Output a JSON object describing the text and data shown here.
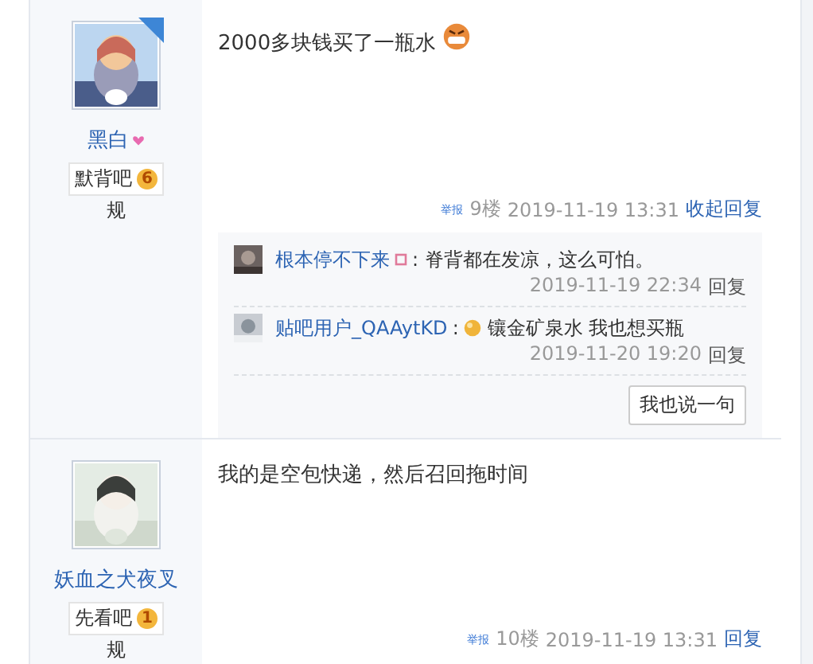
{
  "posts": [
    {
      "author": {
        "name": "黑白",
        "name_icon": true,
        "badge_forum": "默背吧",
        "badge_level": "6",
        "badge_tail": "规"
      },
      "op": true,
      "content": "2000多块钱买了一瓶水",
      "emoticon": {
        "kind": "grimace"
      },
      "report": "举报",
      "floor": "9楼",
      "time": "2019-11-19 13:31",
      "action": "收起回复",
      "replies": [
        {
          "name": "根本停不下来",
          "name_icon": true,
          "text": ": 脊背都在发凉，这么可怕。",
          "time": "2019-11-19 22:34",
          "action": "回复"
        },
        {
          "name": "贴吧用户_QAAytKD",
          "name_icon": false,
          "emoticon": {
            "kind": "orb"
          },
          "text": ": ",
          "text2": "镶金矿泉水 我也想买瓶",
          "time": "2019-11-20 19:20",
          "action": "回复"
        }
      ],
      "reply_button": "我也说一句"
    },
    {
      "author": {
        "name": "妖血之犬夜叉",
        "name_icon": false,
        "badge_forum": "先看吧",
        "badge_level": "1",
        "badge_tail": "规"
      },
      "op": false,
      "content": "我的是空包快递，然后召回拖时间",
      "report": "举报",
      "floor": "10楼",
      "time": "2019-11-19 13:31",
      "action": "回复"
    }
  ]
}
